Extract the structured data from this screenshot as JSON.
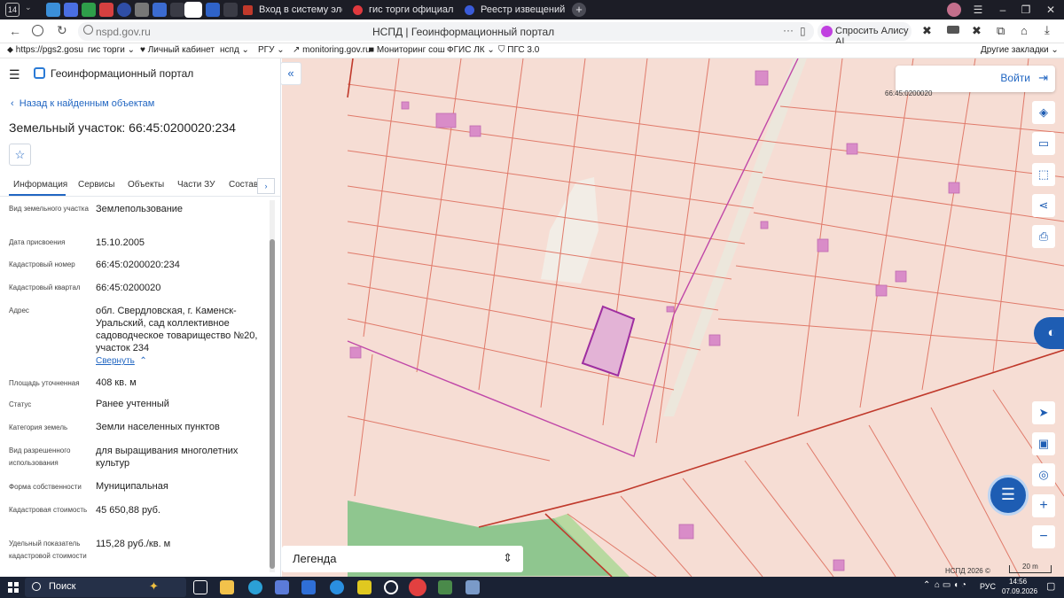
{
  "browser": {
    "tab_counter": "14",
    "tabs": [
      {
        "label": "Вход в систему электрон"
      },
      {
        "label": "гис торги официальный с"
      },
      {
        "label": "Реестр извещений"
      }
    ],
    "address": "nspd.gov.ru",
    "page_title": "НСПД | Геоинформационный портал",
    "alice": "Спросить Алису AI",
    "bookmarks": [
      "https://pgs2.gosu",
      "гис торги",
      "Личный кабинет",
      "нспд",
      "РГУ",
      "monitoring.gov.ru",
      "Мониторинг сош",
      "ФГИС ЛК",
      "ПГС 3.0"
    ],
    "other_bookmarks": "Другие закладки"
  },
  "portal": {
    "title": "Геоинформационный портал"
  },
  "panel": {
    "back": "Назад к найденным объектам",
    "heading": "Земельный участок: 66:45:0200020:234",
    "tabs": [
      "Информация",
      "Сервисы",
      "Объекты",
      "Части ЗУ",
      "Состав"
    ],
    "fields": [
      {
        "label": "Вид земельного участка",
        "value": "Землепользование"
      },
      {
        "label": "Дата присвоения",
        "value": "15.10.2005"
      },
      {
        "label": "Кадастровый номер",
        "value": "66:45:0200020:234"
      },
      {
        "label": "Кадастровый квартал",
        "value": "66:45:0200020"
      },
      {
        "label": "Адрес",
        "value": "обл. Свердловская, г. Каменск-Уральский, сад коллективное садоводческое товарищество №20, участок 234"
      },
      {
        "label": "Площадь уточненная",
        "value": "408 кв. м"
      },
      {
        "label": "Статус",
        "value": "Ранее учтенный"
      },
      {
        "label": "Категория земель",
        "value": "Земли населенных пунктов"
      },
      {
        "label": "Вид разрешенного использования",
        "value": "для выращивания многолетних культур"
      },
      {
        "label": "Форма собственности",
        "value": "Муниципальная"
      },
      {
        "label": "Кадастровая стоимость",
        "value": "45 650,88 руб."
      },
      {
        "label": "Удельный показатель кадастровой стоимости",
        "value": "115,28 руб./кв. м"
      }
    ],
    "collapse": "Свернуть"
  },
  "map": {
    "login": "Войти",
    "quarter_label": "66:45:0200020",
    "legend": "Легенда",
    "copyright": "НСПД 2026 ©",
    "scale": "20 m"
  },
  "taskbar": {
    "search": "Поиск",
    "lang": "РУС",
    "time": "14:56",
    "date": "07.09.2026"
  }
}
